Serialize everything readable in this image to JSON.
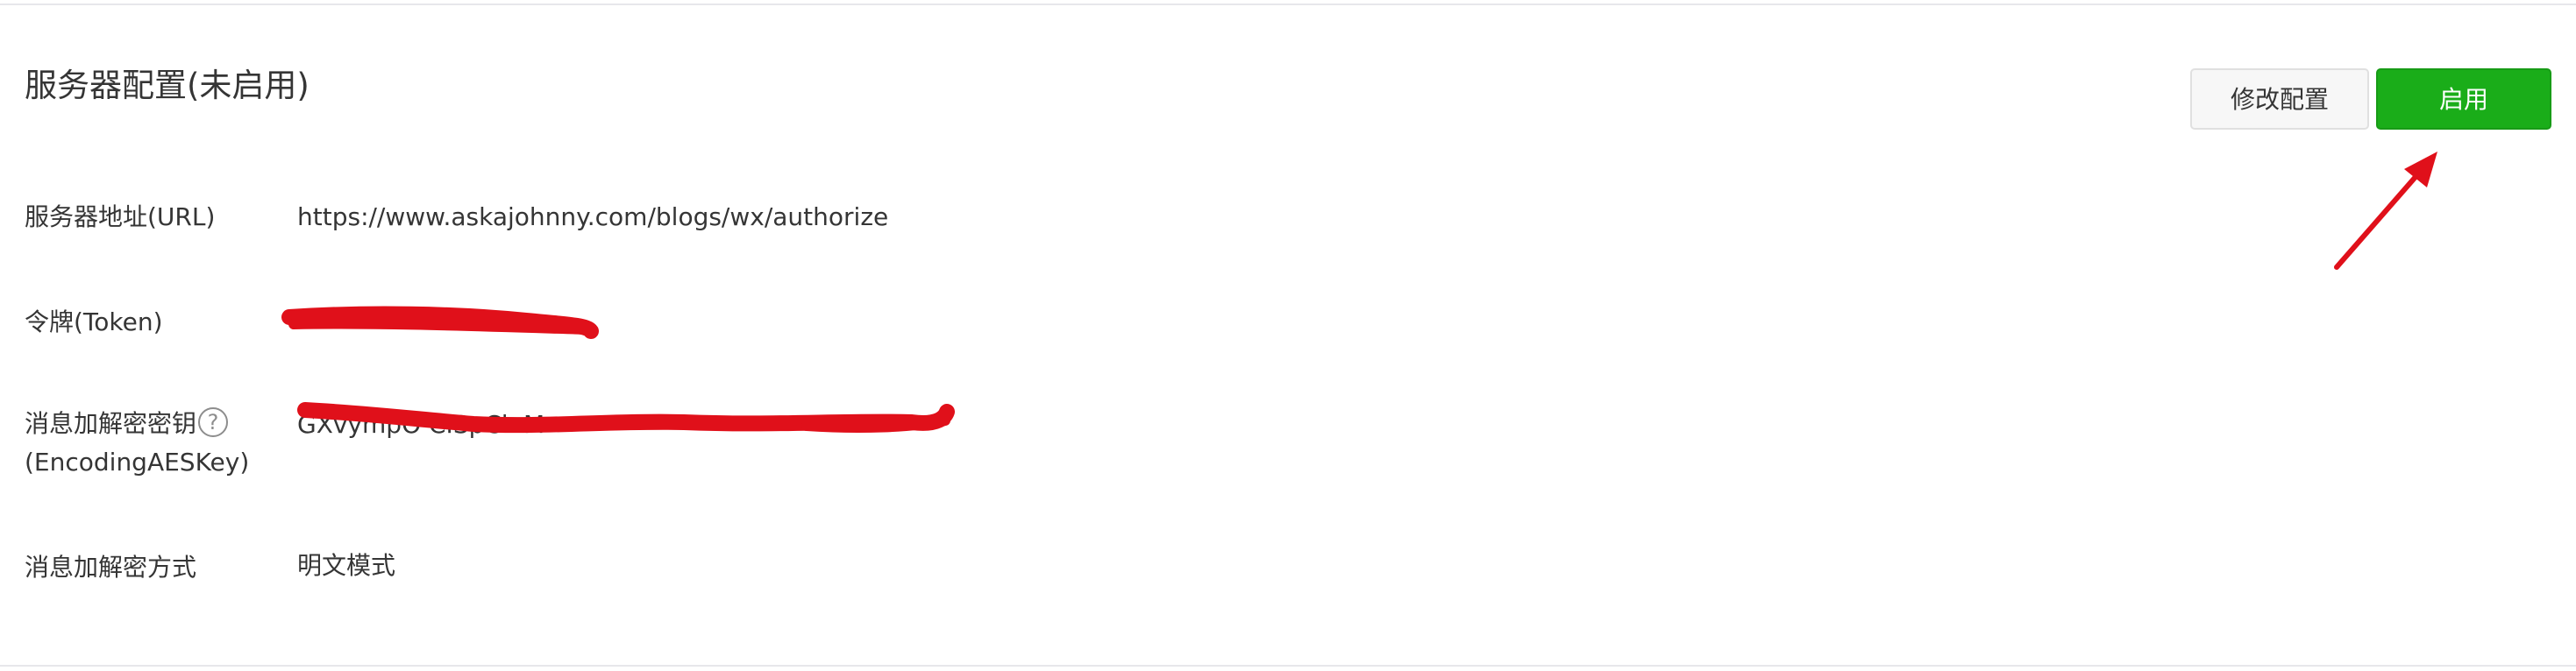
{
  "section": {
    "title": "服务器配置(未启用)"
  },
  "buttons": {
    "modify_label": "修改配置",
    "enable_label": "启用"
  },
  "rows": {
    "url": {
      "label": "服务器地址(URL)",
      "value": "https://www.askajohnny.com/blogs/wx/authorize"
    },
    "token": {
      "label": "令牌(Token)",
      "value": ""
    },
    "aes": {
      "label_line1": "消息加解密密钥",
      "label_line2": "(EncodingAESKey)",
      "help_glyph": "?",
      "value": "GXvympO          CISpCk                                      M"
    },
    "mode": {
      "label": "消息加解密方式",
      "value": "明文模式"
    }
  },
  "colors": {
    "enable_button": "#1aad19",
    "annotation_red": "#e0101a",
    "text": "#353535",
    "divider": "#e7e7eb"
  },
  "icons": {
    "help": "question-circle-icon",
    "annotation": "red-arrow-annotation"
  }
}
